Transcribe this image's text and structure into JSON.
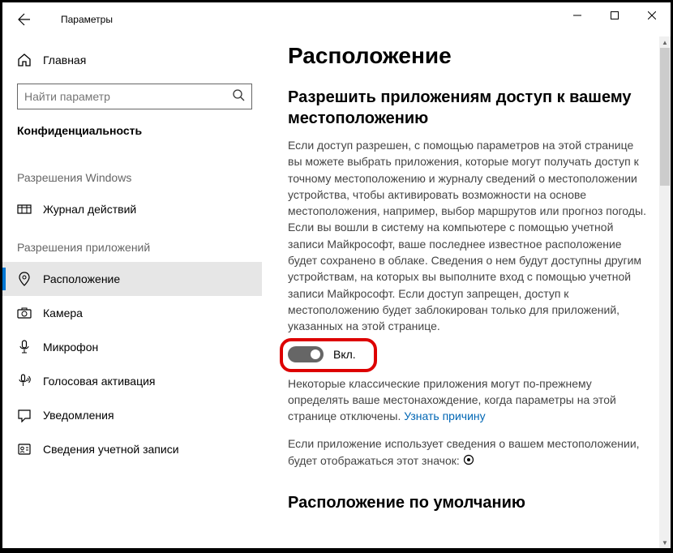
{
  "titlebar": {
    "title": "Параметры"
  },
  "sidebar": {
    "home_label": "Главная",
    "search_placeholder": "Найти параметр",
    "category": "Конфиденциальность",
    "section_windows": "Разрешения Windows",
    "section_apps": "Разрешения приложений",
    "items_windows": [
      {
        "label": "Журнал действий"
      }
    ],
    "items_apps": [
      {
        "label": "Расположение"
      },
      {
        "label": "Камера"
      },
      {
        "label": "Микрофон"
      },
      {
        "label": "Голосовая активация"
      },
      {
        "label": "Уведомления"
      },
      {
        "label": "Сведения учетной записи"
      }
    ]
  },
  "main": {
    "heading": "Расположение",
    "subheading": "Разрешить приложениям доступ к вашему местоположению",
    "desc": "Если доступ разрешен, с помощью параметров на этой странице вы можете выбрать приложения, которые могут получать доступ к точному местоположению и журналу сведений о местоположении устройства, чтобы активировать возможности на основе местоположения, например, выбор маршрутов или прогноз погоды. Если вы вошли в систему на компьютере с помощью учетной записи Майкрософт, ваше последнее известное расположение будет сохранено в облаке. Сведения о нем будут доступны другим устройствам, на которых вы выполните вход с помощью учетной записи Майкрософт. Если доступ запрещен, доступ к местоположению будет заблокирован только для приложений, указанных на этой странице.",
    "toggle_state": "Вкл.",
    "toggle_on": true,
    "legacy_text_1": "Некоторые классические приложения могут по-прежнему определять ваше местонахождение, когда параметры на этой странице отключены. ",
    "legacy_link": "Узнать причину",
    "icon_text_prefix": "Если приложение использует сведения о вашем местоположении,",
    "icon_text_suffix": "будет отображаться этот значок: ",
    "next_heading": "Расположение по умолчанию"
  }
}
